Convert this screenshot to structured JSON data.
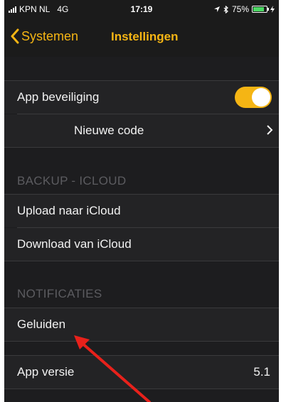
{
  "status_bar": {
    "carrier": "KPN NL",
    "network": "4G",
    "time": "17:19",
    "battery_percent": "75%",
    "battery_level": 0.75
  },
  "nav": {
    "back_label": "Systemen",
    "title": "Instellingen"
  },
  "security": {
    "app_lock_label": "App beveiliging",
    "app_lock_on": true,
    "new_code_label": "Nieuwe code"
  },
  "backup": {
    "header": "BACKUP - ICLOUD",
    "upload_label": "Upload naar iCloud",
    "download_label": "Download van iCloud"
  },
  "notifications": {
    "header": "NOTIFICATIES",
    "sounds_label": "Geluiden"
  },
  "about": {
    "version_label": "App versie",
    "version_value": "5.1"
  },
  "colors": {
    "accent": "#f5b514",
    "background": "#1d1d1f",
    "annotation_arrow": "#e8211b"
  }
}
